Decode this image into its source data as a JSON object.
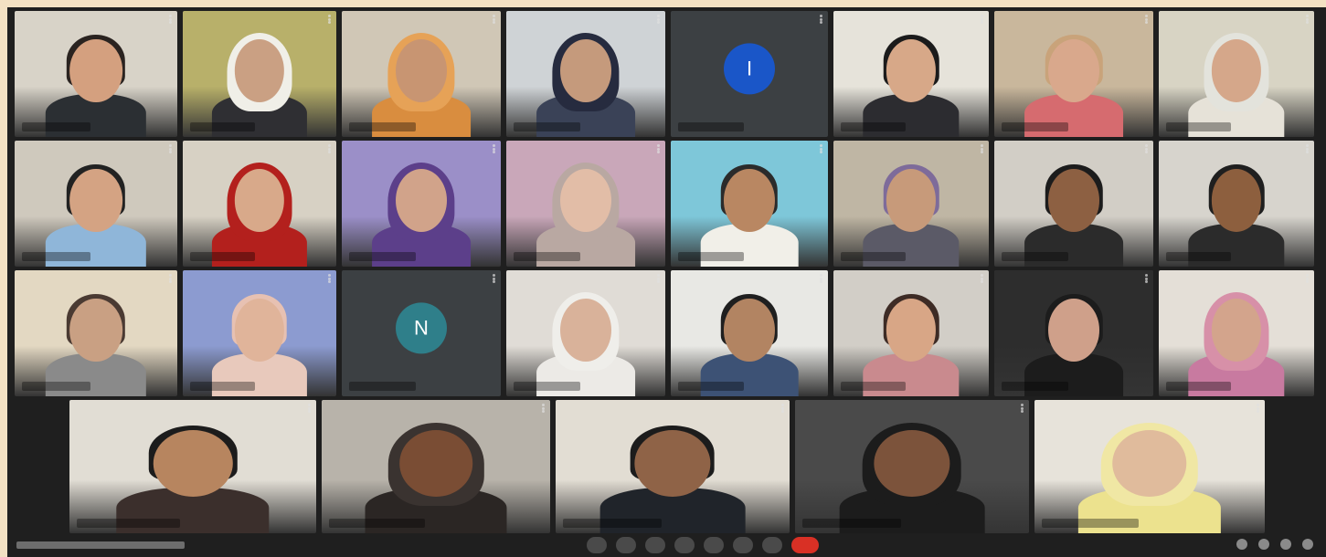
{
  "app": {
    "name": "video-call-gallery"
  },
  "grid": {
    "rows": [
      [
        {
          "kind": "video",
          "bg": "#d8d3c8",
          "skin": "#d4a07f",
          "hair": "#2a2320",
          "shirt": "#2b2f33"
        },
        {
          "kind": "video",
          "bg": "#b8b06a",
          "skin": "#caa083",
          "hair": "#f0efe8",
          "shirt": "#2f2f33",
          "hijab": true
        },
        {
          "kind": "video",
          "bg": "#d0c7b6",
          "skin": "#c89572",
          "hair": "#e6a257",
          "shirt": "#d98d3f",
          "hijab": true
        },
        {
          "kind": "video",
          "bg": "#cfd3d6",
          "skin": "#c59a7c",
          "hair": "#262b3f",
          "shirt": "#3a4257",
          "hijab": true
        },
        {
          "kind": "avatar",
          "initial": "I",
          "color": "#1a56c8"
        },
        {
          "kind": "video",
          "bg": "#e6e3da",
          "skin": "#d7a888",
          "hair": "#1b1b1b",
          "shirt": "#2c2c30"
        },
        {
          "kind": "video",
          "bg": "#c9b79c",
          "skin": "#d9a88c",
          "hair": "#c9a37a",
          "shirt": "#d66b6f"
        },
        {
          "kind": "video",
          "bg": "#d8d4c4",
          "skin": "#d5a78a",
          "hair": "#e3e3dc",
          "shirt": "#e6e2d8",
          "hijab": true
        }
      ],
      [
        {
          "kind": "video",
          "bg": "#cfc9bd",
          "skin": "#d4a383",
          "hair": "#222222",
          "shirt": "#8fb6d9"
        },
        {
          "kind": "video",
          "bg": "#d7d1c4",
          "skin": "#d8a98a",
          "hair": "#b3201d",
          "shirt": "#b3201d",
          "hijab": true
        },
        {
          "kind": "video",
          "bg": "#9b8fc8",
          "skin": "#d1a38a",
          "hair": "#5c3f8a",
          "shirt": "#5c3f8a",
          "hijab": true
        },
        {
          "kind": "video",
          "bg": "#c9a7b9",
          "skin": "#e2bda7",
          "hair": "#b9a8a2",
          "shirt": "#b9a8a2",
          "hijab": true
        },
        {
          "kind": "video",
          "bg": "#7ec7d9",
          "skin": "#b98762",
          "hair": "#2b2b2b",
          "shirt": "#f1efe8"
        },
        {
          "kind": "video",
          "bg": "#bfb6a4",
          "skin": "#c79a7a",
          "hair": "#7e6b9a",
          "shirt": "#5b5a67"
        },
        {
          "kind": "video",
          "bg": "#d2cec6",
          "skin": "#8d6042",
          "hair": "#1c1c1c",
          "shirt": "#2b2b2b"
        },
        {
          "kind": "video",
          "bg": "#d7d4cd",
          "skin": "#8d5f3e",
          "hair": "#1f1f1f",
          "shirt": "#2b2b2b"
        }
      ],
      [
        {
          "kind": "video",
          "bg": "#e3d8c2",
          "skin": "#c9a083",
          "hair": "#4a3a32",
          "shirt": "#8a8a8a"
        },
        {
          "kind": "video",
          "bg": "#8c9bd0",
          "skin": "#e0b49a",
          "hair": "#e7c1b2",
          "shirt": "#e8c9bc"
        },
        {
          "kind": "avatar",
          "initial": "N",
          "color": "#2f7f8a"
        },
        {
          "kind": "video",
          "bg": "#e0dcd6",
          "skin": "#d9b29a",
          "hair": "#efeeea",
          "shirt": "#eceae6",
          "hijab": true
        },
        {
          "kind": "video",
          "bg": "#e8e8e4",
          "skin": "#b28462",
          "hair": "#1f1f1f",
          "shirt": "#3d5275"
        },
        {
          "kind": "video",
          "bg": "#d2cec7",
          "skin": "#d8a686",
          "hair": "#3d2b25",
          "shirt": "#c98a8e"
        },
        {
          "kind": "video",
          "bg": "#2d2d2d",
          "skin": "#cfa08a",
          "hair": "#1c1c1c",
          "shirt": "#1c1c1c"
        },
        {
          "kind": "video",
          "bg": "#e4dfd7",
          "skin": "#d3a48c",
          "hair": "#d790a8",
          "shirt": "#c87aa0",
          "hijab": true
        }
      ],
      [
        {
          "kind": "video",
          "bg": "#e1ddd4",
          "skin": "#b7855f",
          "hair": "#1c1c1c",
          "shirt": "#3b2f2c"
        },
        {
          "kind": "video",
          "bg": "#b8b3aa",
          "skin": "#7a4d34",
          "hair": "#3a3330",
          "shirt": "#2b2624",
          "hijab": true
        },
        {
          "kind": "video",
          "bg": "#e2ddd3",
          "skin": "#8f6347",
          "hair": "#1c1c1c",
          "shirt": "#20242a"
        },
        {
          "kind": "video",
          "bg": "#4a4a4a",
          "skin": "#7c533b",
          "hair": "#1c1c1c",
          "shirt": "#1c1c1c",
          "hijab": true
        },
        {
          "kind": "video",
          "bg": "#e7e3da",
          "skin": "#e0bb9c",
          "hair": "#f0e7a4",
          "shirt": "#ece28e",
          "hijab": true
        }
      ]
    ]
  }
}
